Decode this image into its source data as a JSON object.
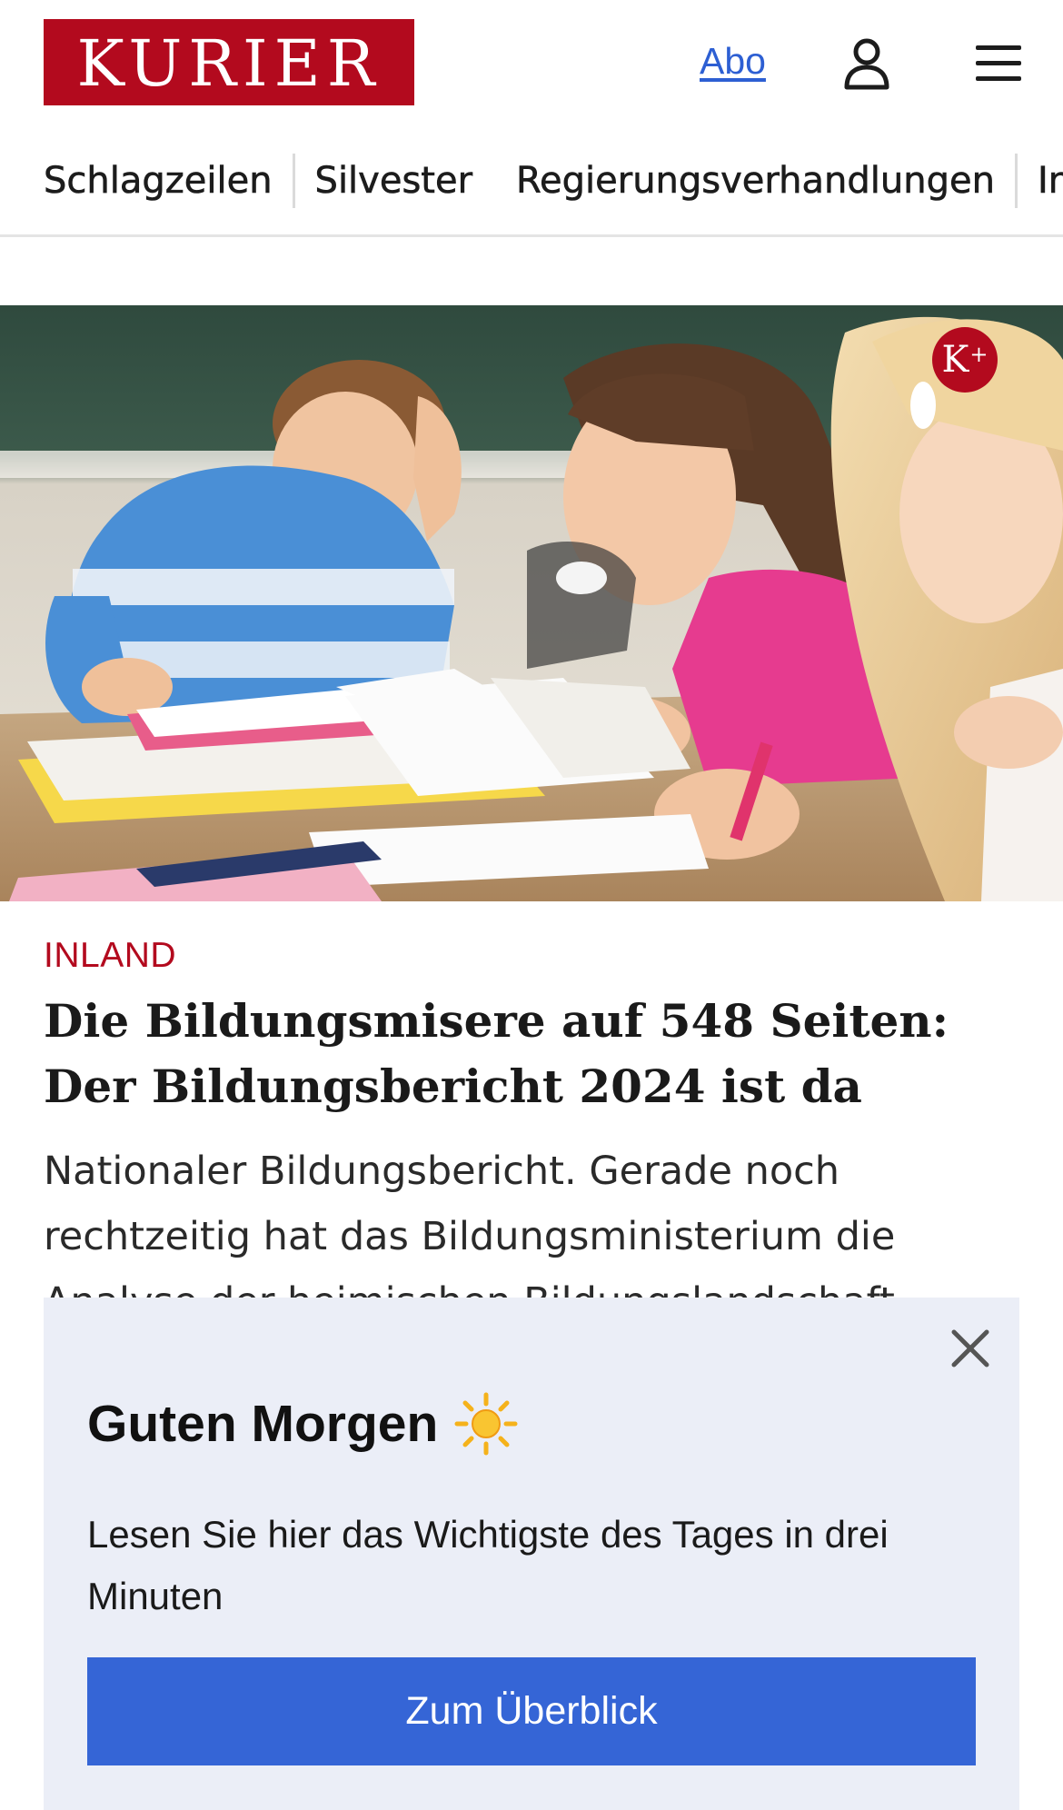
{
  "header": {
    "logo_text": "KURIER",
    "abo_label": "Abo",
    "user_icon": "user-icon",
    "menu_icon": "hamburger-menu-icon"
  },
  "nav": {
    "items": [
      {
        "label": "Schlagzeilen"
      },
      {
        "label": "Silvester"
      },
      {
        "label": "Regierungsverhandlungen"
      },
      {
        "label": "Inla"
      }
    ]
  },
  "article": {
    "badge_text": "K",
    "badge_plus": "+",
    "category": "INLAND",
    "headline": "Die Bildungsmisere auf 548 Seiten: Der Bildungsbericht 2024 ist da",
    "teaser": "Nationaler Bildungsbericht. Gerade noch rechtzeitig hat das Bildungsministerium die Analyse der heimischen Bildungslandschaft"
  },
  "popup": {
    "title": "Guten Morgen",
    "title_icon": "sun-icon",
    "text": "Lesen Sie hier das Wichtigste des Tages in drei Minuten",
    "button_label": "Zum Überblick",
    "close_icon": "close-icon"
  },
  "colors": {
    "brand_red": "#b30a1e",
    "link_blue": "#2d5fd3",
    "button_blue": "#3565d6",
    "popup_bg": "#ebeef7"
  }
}
